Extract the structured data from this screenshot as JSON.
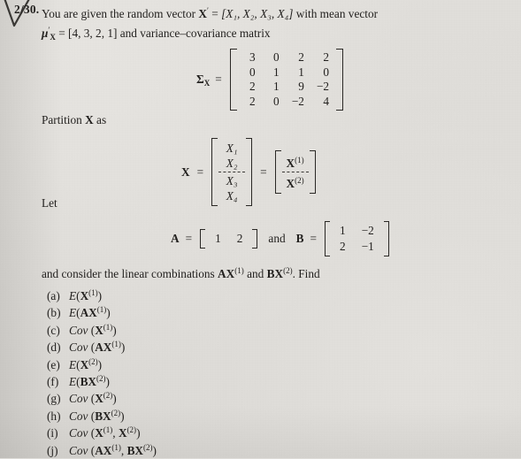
{
  "problem": {
    "number_mark": "2/30.",
    "handwritten_check": "checkmark"
  },
  "intro": {
    "line1_a": "You are given the random vector ",
    "vector_sym": "X",
    "prime": "′",
    "equals": " = ",
    "vector_entries": "[X₁, X₂, X₃, X₄]",
    "line1_b": " with mean vector",
    "mu_sym": "μ",
    "mu_prime": "′",
    "mu_sub": "X",
    "mu_value": " = [4, 3, 2, 1] and variance–covariance matrix"
  },
  "sigma": {
    "label": "Σ",
    "label_sub": "X",
    "equals": "=",
    "rows": [
      [
        "3",
        "0",
        "2",
        "2"
      ],
      [
        "0",
        "1",
        "1",
        "0"
      ],
      [
        "2",
        "1",
        "9",
        "−2"
      ],
      [
        "2",
        "0",
        "−2",
        "4"
      ]
    ]
  },
  "partition": {
    "caption": "Partition X as",
    "let_caption": "Let",
    "x_symbol": "X",
    "equals": "=",
    "entries_top": [
      "X₁",
      "X₂"
    ],
    "entries_bottom": [
      "X₃",
      "X₄"
    ],
    "block_top": "X(1)",
    "block_bottom": "X(2)",
    "block_top_base": "X",
    "block_top_sup": "(1)",
    "block_bottom_base": "X",
    "block_bottom_sup": "(2)"
  },
  "matrices": {
    "a_label": "A",
    "a_equals": "=",
    "a_values": [
      "1",
      "2"
    ],
    "and_text": "and",
    "b_label": "B",
    "b_equals": "=",
    "b_rows": [
      [
        "1",
        "−2"
      ],
      [
        "2",
        "−1"
      ]
    ]
  },
  "consider": {
    "text_a": "and consider the linear combinations ",
    "comb1_base": "AX",
    "comb1_sup": "(1)",
    "text_b": " and ",
    "comb2_base": "BX",
    "comb2_sup": "(2)",
    "text_c": ". Find"
  },
  "questions": [
    {
      "label": "(a)",
      "fn": "E",
      "open": "(",
      "arg_base": "X",
      "arg_sup": "(1)",
      "arg2_base": "",
      "arg2_sup": "",
      "close": ")"
    },
    {
      "label": "(b)",
      "fn": "E",
      "open": "(",
      "arg_base": "AX",
      "arg_sup": "(1)",
      "arg2_base": "",
      "arg2_sup": "",
      "close": ")"
    },
    {
      "label": "(c)",
      "fn": "Cov",
      "open": "(",
      "arg_base": "X",
      "arg_sup": "(1)",
      "arg2_base": "",
      "arg2_sup": "",
      "close": ")"
    },
    {
      "label": "(d)",
      "fn": "Cov",
      "open": "(",
      "arg_base": "AX",
      "arg_sup": "(1)",
      "arg2_base": "",
      "arg2_sup": "",
      "close": ")"
    },
    {
      "label": "(e)",
      "fn": "E",
      "open": "(",
      "arg_base": "X",
      "arg_sup": "(2)",
      "arg2_base": "",
      "arg2_sup": "",
      "close": ")"
    },
    {
      "label": "(f)",
      "fn": "E",
      "open": "(",
      "arg_base": "BX",
      "arg_sup": "(2)",
      "arg2_base": "",
      "arg2_sup": "",
      "close": ")"
    },
    {
      "label": "(g)",
      "fn": "Cov",
      "open": "(",
      "arg_base": "X",
      "arg_sup": "(2)",
      "arg2_base": "",
      "arg2_sup": "",
      "close": ")"
    },
    {
      "label": "(h)",
      "fn": "Cov",
      "open": "(",
      "arg_base": "BX",
      "arg_sup": "(2)",
      "arg2_base": "",
      "arg2_sup": "",
      "close": ")"
    },
    {
      "label": "(i)",
      "fn": "Cov",
      "open": "(",
      "arg_base": "X",
      "arg_sup": "(1)",
      "arg2_base": "X",
      "arg2_sup": "(2)",
      "close": ")"
    },
    {
      "label": "(j)",
      "fn": "Cov",
      "open": "(",
      "arg_base": "AX",
      "arg_sup": "(1)",
      "arg2_base": "BX",
      "arg2_sup": "(2)",
      "close": ")"
    }
  ],
  "colors": {
    "paper": "#dedcd8",
    "ink": "#23211f"
  }
}
